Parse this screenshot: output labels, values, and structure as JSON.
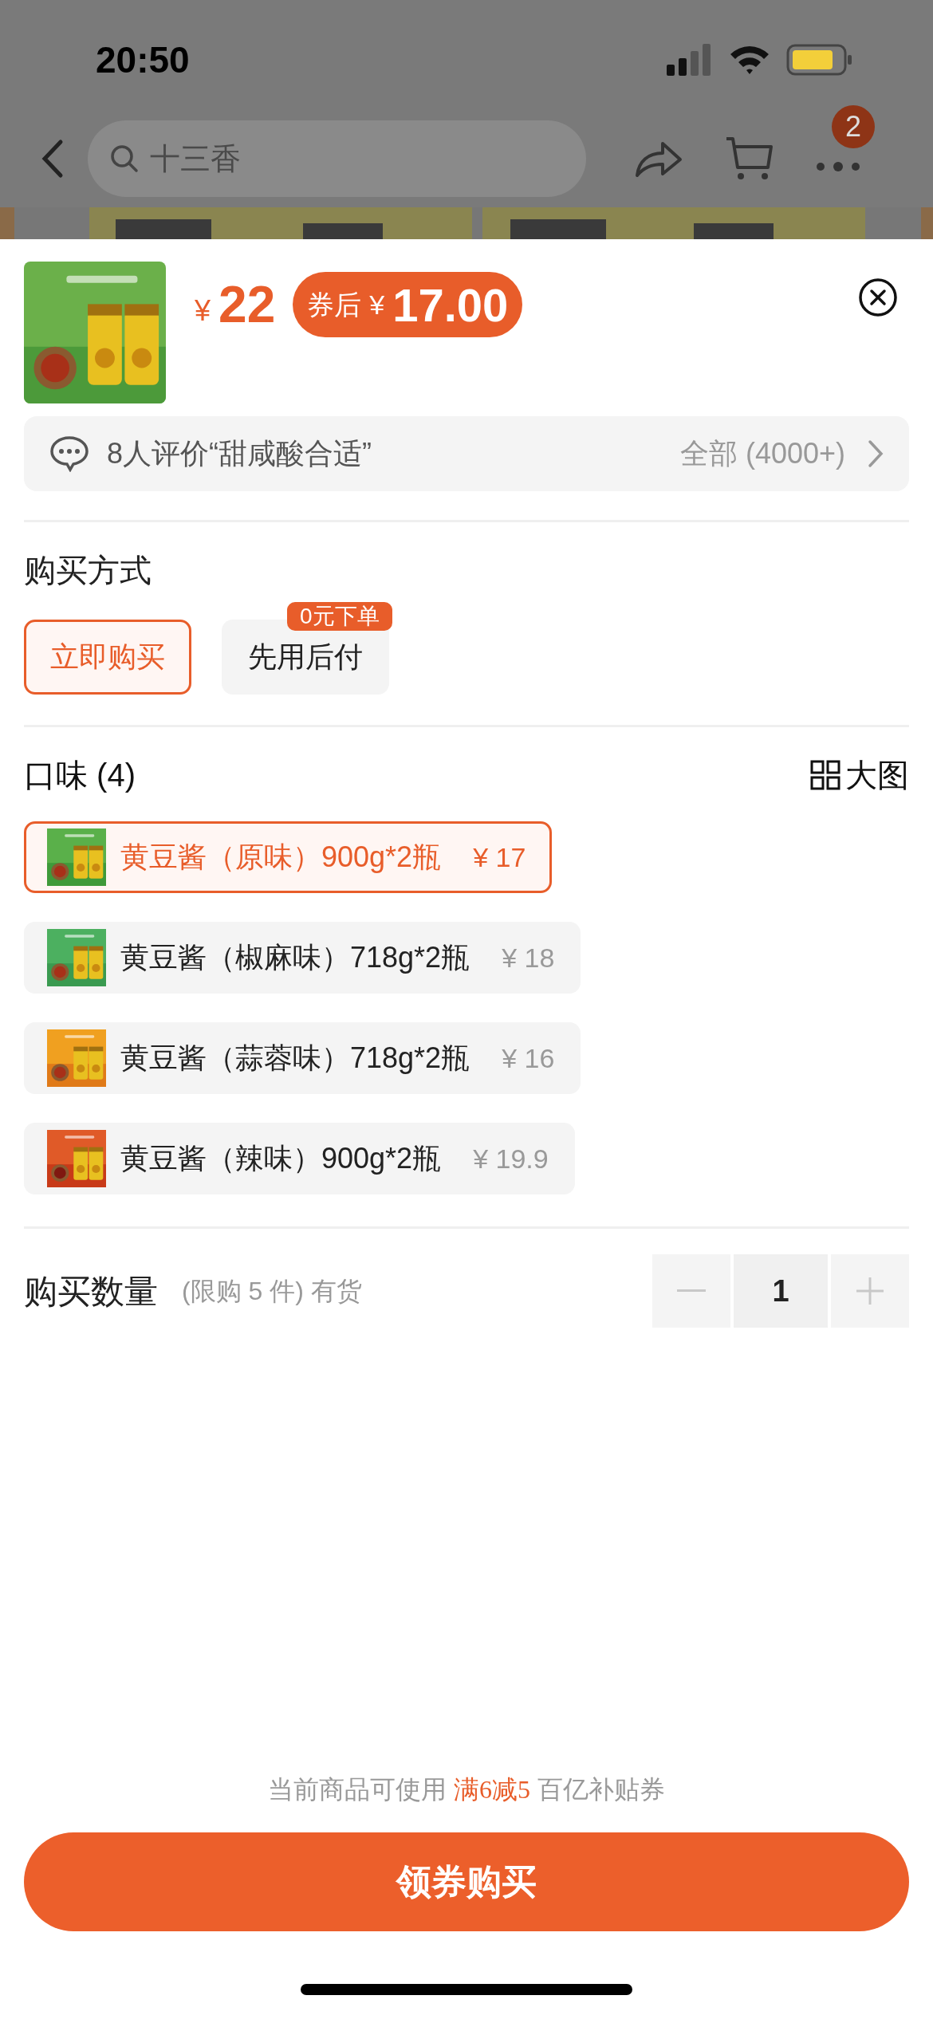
{
  "status_bar": {
    "time": "20:50"
  },
  "nav": {
    "search_placeholder": "十三香",
    "more_badge": "2"
  },
  "product": {
    "price_symbol": "¥",
    "price": "22",
    "coupon_label": "券后",
    "coupon_symbol": "¥",
    "coupon_price": "17.00"
  },
  "reviews": {
    "summary": "8人评价“甜咸酸合适”",
    "all": "全部 (4000+)"
  },
  "purchase_method": {
    "title": "购买方式",
    "options": [
      {
        "label": "立即购买",
        "selected": true
      },
      {
        "label": "先用后付",
        "selected": false,
        "badge": "0元下单"
      }
    ]
  },
  "flavor": {
    "title": "口味 (4)",
    "big_image": "大图",
    "options": [
      {
        "label": "黄豆酱（原味）900g*2瓶",
        "price": "¥ 17",
        "selected": true
      },
      {
        "label": "黄豆酱（椒麻味）718g*2瓶",
        "price": "¥ 18",
        "selected": false
      },
      {
        "label": "黄豆酱（蒜蓉味）718g*2瓶",
        "price": "¥ 16",
        "selected": false
      },
      {
        "label": "黄豆酱（辣味）900g*2瓶",
        "price": "¥ 19.9",
        "selected": false
      }
    ]
  },
  "quantity": {
    "title": "购买数量",
    "note": "(限购 5 件) 有货",
    "value": "1"
  },
  "coupon_note": "当前商品可使用 **满6减5** 百亿补贴券",
  "buy_button": "领券购买"
}
